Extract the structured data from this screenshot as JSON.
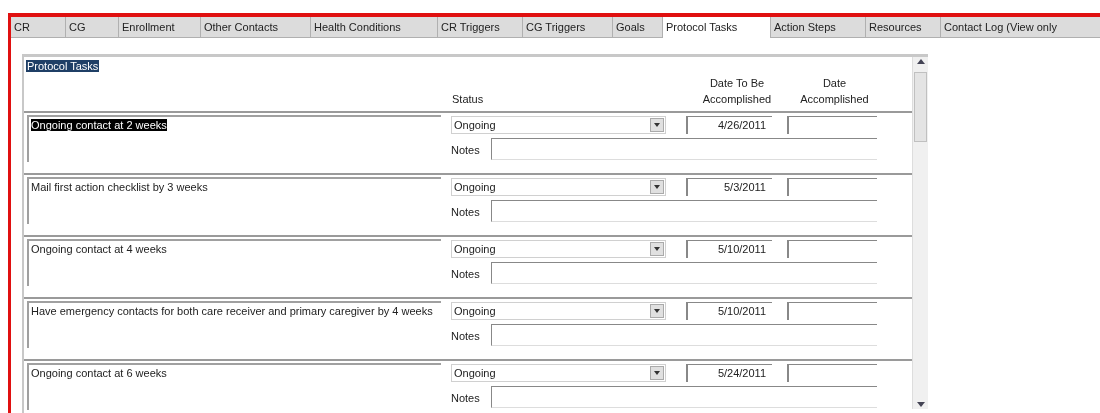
{
  "tabs": [
    {
      "label": "CR",
      "selected": false
    },
    {
      "label": "CG",
      "selected": false
    },
    {
      "label": "Enrollment",
      "selected": false
    },
    {
      "label": "Other Contacts",
      "selected": false
    },
    {
      "label": "Health Conditions",
      "selected": false
    },
    {
      "label": "CR Triggers",
      "selected": false
    },
    {
      "label": "CG Triggers",
      "selected": false
    },
    {
      "label": "Goals",
      "selected": false
    },
    {
      "label": "Protocol Tasks",
      "selected": true
    },
    {
      "label": "Action Steps",
      "selected": false
    },
    {
      "label": "Resources",
      "selected": false
    },
    {
      "label": "Contact Log (View only",
      "selected": false
    }
  ],
  "panel": {
    "title": "Protocol Tasks",
    "title_selected": true,
    "columns": [
      "Status",
      "Date To Be Accomplished",
      "Date Accomplished"
    ],
    "tasks": [
      {
        "task": "Ongoing contact at 2 weeks",
        "selected": true,
        "status": "Ongoing",
        "date_to_be_accomplished": "4/26/2011",
        "notes_label": "Notes"
      },
      {
        "task": "Mail first action checklist by 3 weeks",
        "selected": false,
        "status": "Ongoing",
        "date_to_be_accomplished": "5/3/2011",
        "notes_label": "Notes"
      },
      {
        "task": "Ongoing contact at 4 weeks",
        "selected": false,
        "status": "Ongoing",
        "date_to_be_accomplished": "5/10/2011",
        "notes_label": "Notes"
      },
      {
        "task": "Have emergency contacts for both care receiver and primary caregiver by 4 weeks",
        "selected": false,
        "status": "Ongoing",
        "date_to_be_accomplished": "5/10/2011",
        "notes_label": "Notes"
      },
      {
        "task": "Ongoing contact at 6 weeks",
        "selected": false,
        "status": "Ongoing",
        "date_to_be_accomplished": "5/24/2011",
        "notes_label": "Notes"
      }
    ]
  }
}
